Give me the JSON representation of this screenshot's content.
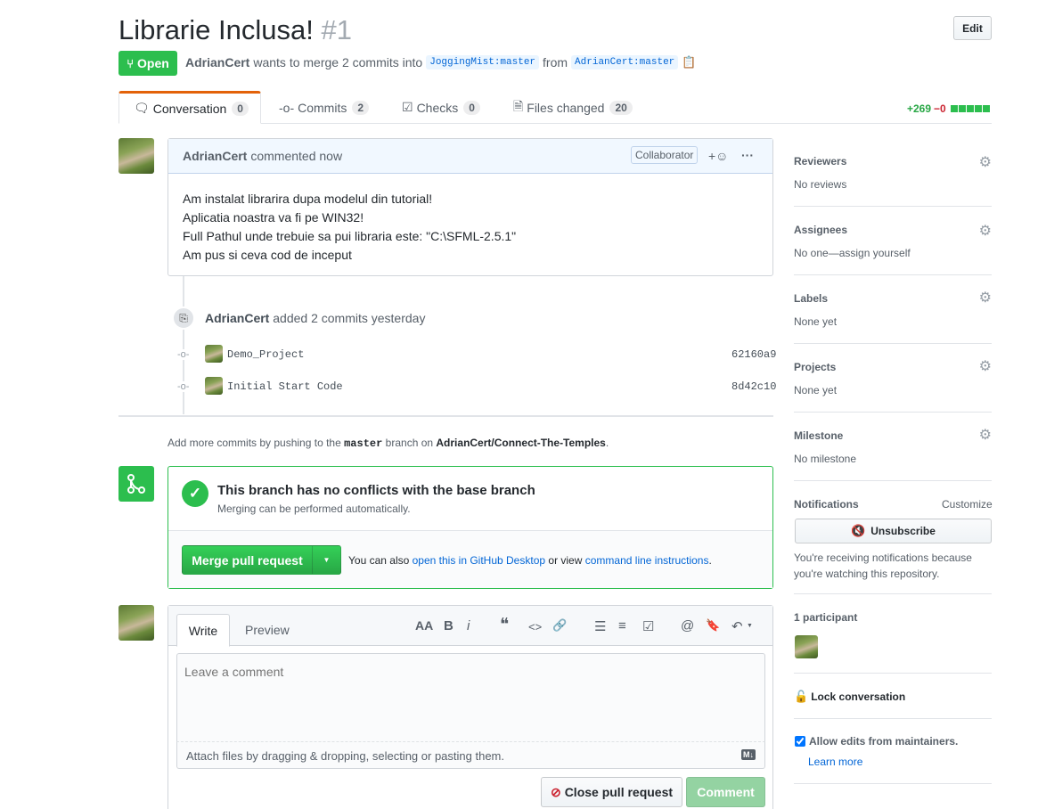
{
  "pr": {
    "title": "Librarie Inclusa!",
    "number": "#1",
    "edit_label": "Edit",
    "state_label": "Open",
    "author": "AdrianCert",
    "merge_text": "wants to merge 2 commits into",
    "base_branch": "JoggingMist:master",
    "from_text": "from",
    "head_branch": "AdrianCert:master"
  },
  "tabs": [
    {
      "label": "Conversation",
      "count": "0"
    },
    {
      "label": "Commits",
      "count": "2"
    },
    {
      "label": "Checks",
      "count": "0"
    },
    {
      "label": "Files changed",
      "count": "20"
    }
  ],
  "diffstat": {
    "additions": "+269",
    "deletions": "−0"
  },
  "comment": {
    "author": "AdrianCert",
    "action": "commented now",
    "role_badge": "Collaborator",
    "reaction_label": "+☺",
    "more_label": "···",
    "lines": [
      "Am instalat librarira dupa modelul din tutorial!",
      "Aplicatia noastra va fi pe WIN32!",
      "Full Pathul unde trebuie sa pui libraria este: \"C:\\SFML-2.5.1\"",
      "Am pus si ceva cod de inceput"
    ]
  },
  "commits_event": {
    "author": "AdrianCert",
    "action": "added 2 commits yesterday",
    "commits": [
      {
        "message": "Demo_Project",
        "sha": "62160a9"
      },
      {
        "message": "Initial Start Code",
        "sha": "8d42c10"
      }
    ]
  },
  "push_hint": {
    "prefix": "Add more commits by pushing to the",
    "branch": "master",
    "middle": "branch on",
    "repo": "AdrianCert/Connect-The-Temples",
    "suffix": "."
  },
  "merge_box": {
    "title": "This branch has no conflicts with the base branch",
    "subtitle": "Merging can be performed automatically.",
    "button_label": "Merge pull request",
    "also_text": "You can also",
    "desktop_link": "open this in GitHub Desktop",
    "or_view": "or view",
    "cli_link": "command line instructions",
    "period": "."
  },
  "composer": {
    "tab_write": "Write",
    "tab_preview": "Preview",
    "placeholder": "Leave a comment",
    "attach_text": "Attach files by dragging & dropping, selecting or pasting them.",
    "md_badge": "M↓",
    "close_label": "Close pull request",
    "comment_label": "Comment",
    "toolbar": [
      "AA",
      "B",
      "i",
      "❝",
      "<>",
      "🔗",
      "☰",
      "≡",
      "☑",
      "@",
      "🔖",
      "↶"
    ]
  },
  "sidebar": {
    "reviewers": {
      "title": "Reviewers",
      "value": "No reviews"
    },
    "assignees": {
      "title": "Assignees",
      "value": "No one—assign yourself"
    },
    "labels": {
      "title": "Labels",
      "value": "None yet"
    },
    "projects": {
      "title": "Projects",
      "value": "None yet"
    },
    "milestone": {
      "title": "Milestone",
      "value": "No milestone"
    },
    "notifications": {
      "title": "Notifications",
      "customize": "Customize",
      "button": "Unsubscribe",
      "reason_1": "You're receiving notifications because",
      "reason_2": "you're watching this repository."
    },
    "participants": "1 participant",
    "lock": "Lock conversation",
    "allow_edits": "Allow edits from maintainers.",
    "learn_more": "Learn more"
  },
  "colors": {
    "green": "#2cbe4e",
    "link": "#0366d6",
    "red": "#cb2431",
    "merge_green": "#28a745"
  }
}
